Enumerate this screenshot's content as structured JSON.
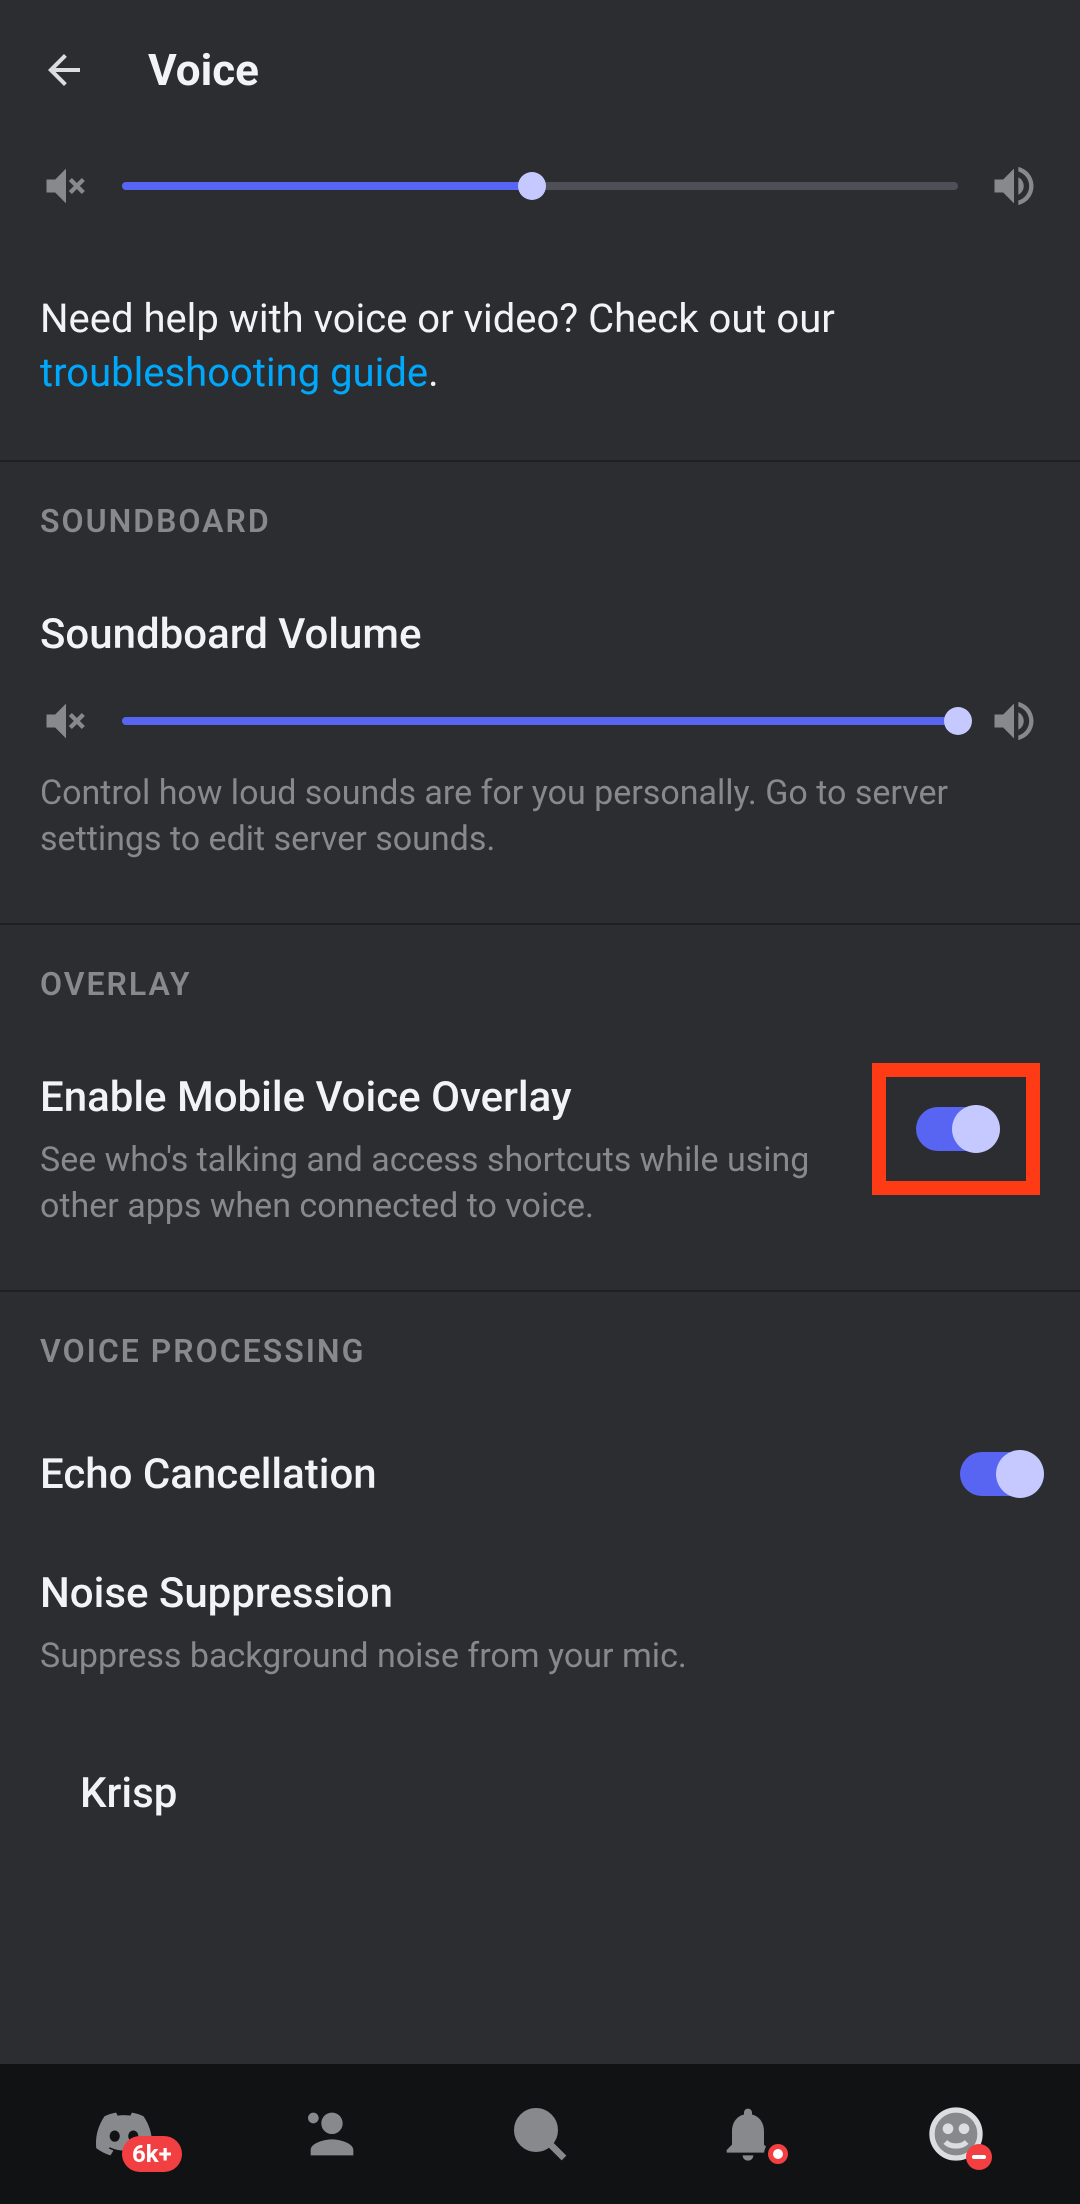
{
  "header": {
    "title": "Voice"
  },
  "topSlider": {
    "percent": 49
  },
  "help": {
    "prefix": "Need help with voice or video? Check out our ",
    "link": "troubleshooting guide",
    "suffix": "."
  },
  "soundboard": {
    "header": "SOUNDBOARD",
    "title": "Soundboard Volume",
    "desc": "Control how loud sounds are for you personally. Go to server settings to edit server sounds.",
    "percent": 100
  },
  "overlay": {
    "header": "OVERLAY",
    "title": "Enable Mobile Voice Overlay",
    "desc": "See who's talking and access shortcuts while using other apps when connected to voice.",
    "enabled": true
  },
  "voiceProcessing": {
    "header": "VOICE PROCESSING",
    "echo": {
      "title": "Echo Cancellation",
      "enabled": true
    },
    "noise": {
      "title": "Noise Suppression",
      "desc": "Suppress background noise from your mic."
    },
    "krisp": "Krisp"
  },
  "nav": {
    "badge": "6k+"
  }
}
